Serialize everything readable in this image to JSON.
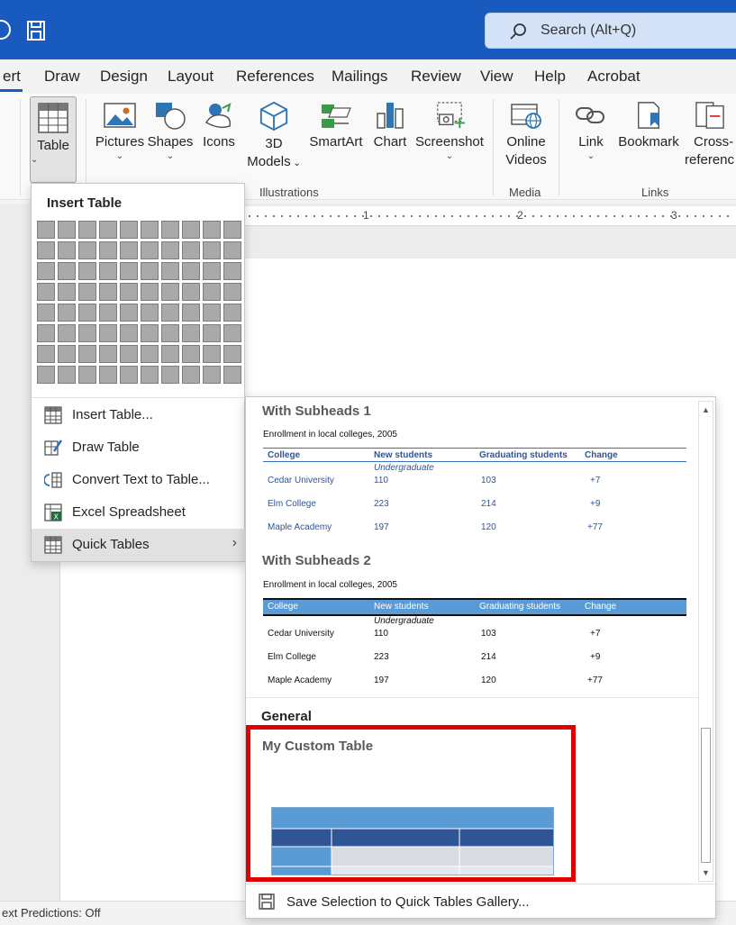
{
  "search": {
    "placeholder": "Search (Alt+Q)"
  },
  "tabs": [
    {
      "label": "ert"
    },
    {
      "label": "Draw"
    },
    {
      "label": "Design"
    },
    {
      "label": "Layout"
    },
    {
      "label": "References"
    },
    {
      "label": "Mailings"
    },
    {
      "label": "Review"
    },
    {
      "label": "View"
    },
    {
      "label": "Help"
    },
    {
      "label": "Acrobat"
    }
  ],
  "ribbon": {
    "table": "Table",
    "pictures": "Pictures",
    "shapes": "Shapes",
    "icons": "Icons",
    "models_line1": "3D",
    "models_line2": "Models",
    "smartart": "SmartArt",
    "chart": "Chart",
    "screenshot": "Screenshot",
    "online_videos_line1": "Online",
    "online_videos_line2": "Videos",
    "link": "Link",
    "bookmark": "Bookmark",
    "cross_ref_line1": "Cross-",
    "cross_ref_line2": "referenc",
    "groups": {
      "illustrations": "Illustrations",
      "media": "Media",
      "links": "Links"
    }
  },
  "ruler": {
    "marks": [
      "1",
      "2",
      "3"
    ]
  },
  "status": {
    "text": "ext Predictions: Off"
  },
  "insert_table": {
    "title": "Insert Table",
    "items": [
      {
        "label": "Insert Table..."
      },
      {
        "label": "Draw Table"
      },
      {
        "label": "Convert Text to Table..."
      },
      {
        "label": "Excel Spreadsheet"
      },
      {
        "label": "Quick Tables",
        "arrow": "›"
      }
    ]
  },
  "gallery": {
    "subheads1": {
      "title": "With Subheads 1",
      "caption": "Enrollment in local colleges, 2005",
      "headers": [
        "College",
        "New students",
        "Graduating students",
        "Change"
      ],
      "subhead": "Undergraduate",
      "rows": [
        [
          "Cedar University",
          "110",
          "103",
          "+7"
        ],
        [
          "Elm College",
          "223",
          "214",
          "+9"
        ],
        [
          "Maple Academy",
          "197",
          "120",
          "+77"
        ]
      ]
    },
    "subheads2": {
      "title": "With Subheads 2",
      "caption": "Enrollment in local colleges, 2005",
      "headers": [
        "College",
        "New students",
        "Graduating students",
        "Change"
      ],
      "subhead": "Undergraduate",
      "rows": [
        [
          "Cedar University",
          "110",
          "103",
          "+7"
        ],
        [
          "Elm College",
          "223",
          "214",
          "+9"
        ],
        [
          "Maple Academy",
          "197",
          "120",
          "+77"
        ]
      ]
    },
    "general_label": "General",
    "custom_title": "My Custom Table",
    "footer": "Save Selection to Quick Tables Gallery..."
  },
  "colors": {
    "titlebar": "#185abd",
    "highlight": "#e00000",
    "table_blue": "#5b9bd5",
    "table_dark": "#2f5597"
  }
}
